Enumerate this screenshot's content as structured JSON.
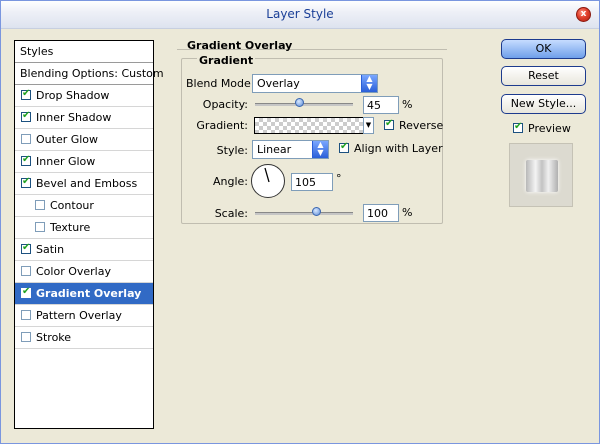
{
  "window": {
    "title": "Layer Style",
    "close_glyph": "x"
  },
  "styles_panel": {
    "header": "Styles",
    "blending_options": "Blending Options: Custom",
    "items": [
      {
        "label": "Drop Shadow",
        "checked": true,
        "sub": false,
        "selected": false
      },
      {
        "label": "Inner Shadow",
        "checked": true,
        "sub": false,
        "selected": false
      },
      {
        "label": "Outer Glow",
        "checked": false,
        "sub": false,
        "selected": false
      },
      {
        "label": "Inner Glow",
        "checked": true,
        "sub": false,
        "selected": false
      },
      {
        "label": "Bevel and Emboss",
        "checked": true,
        "sub": false,
        "selected": false
      },
      {
        "label": "Contour",
        "checked": false,
        "sub": true,
        "selected": false
      },
      {
        "label": "Texture",
        "checked": false,
        "sub": true,
        "selected": false
      },
      {
        "label": "Satin",
        "checked": true,
        "sub": false,
        "selected": false
      },
      {
        "label": "Color Overlay",
        "checked": false,
        "sub": false,
        "selected": false
      },
      {
        "label": "Gradient Overlay",
        "checked": true,
        "sub": false,
        "selected": true
      },
      {
        "label": "Pattern Overlay",
        "checked": false,
        "sub": false,
        "selected": false
      },
      {
        "label": "Stroke",
        "checked": false,
        "sub": false,
        "selected": false
      }
    ]
  },
  "gradient_overlay": {
    "section_title": "Gradient Overlay",
    "group_title": "Gradient",
    "blend_mode_label": "Blend Mode:",
    "blend_mode_value": "Overlay",
    "opacity_label": "Opacity:",
    "opacity_value": "45",
    "opacity_unit": "%",
    "gradient_label": "Gradient:",
    "reverse_label": "Reverse",
    "reverse_checked": true,
    "style_label": "Style:",
    "style_value": "Linear",
    "align_label": "Align with Layer",
    "align_checked": true,
    "angle_label": "Angle:",
    "angle_value": "105",
    "angle_unit": "°",
    "scale_label": "Scale:",
    "scale_value": "100",
    "scale_unit": "%"
  },
  "buttons": {
    "ok": "OK",
    "reset": "Reset",
    "new_style": "New Style...",
    "preview_label": "Preview",
    "preview_checked": true
  },
  "colors": {
    "selection": "#316ac5",
    "title_text": "#1a3f97",
    "dialog_bg": "#ece9d8"
  }
}
